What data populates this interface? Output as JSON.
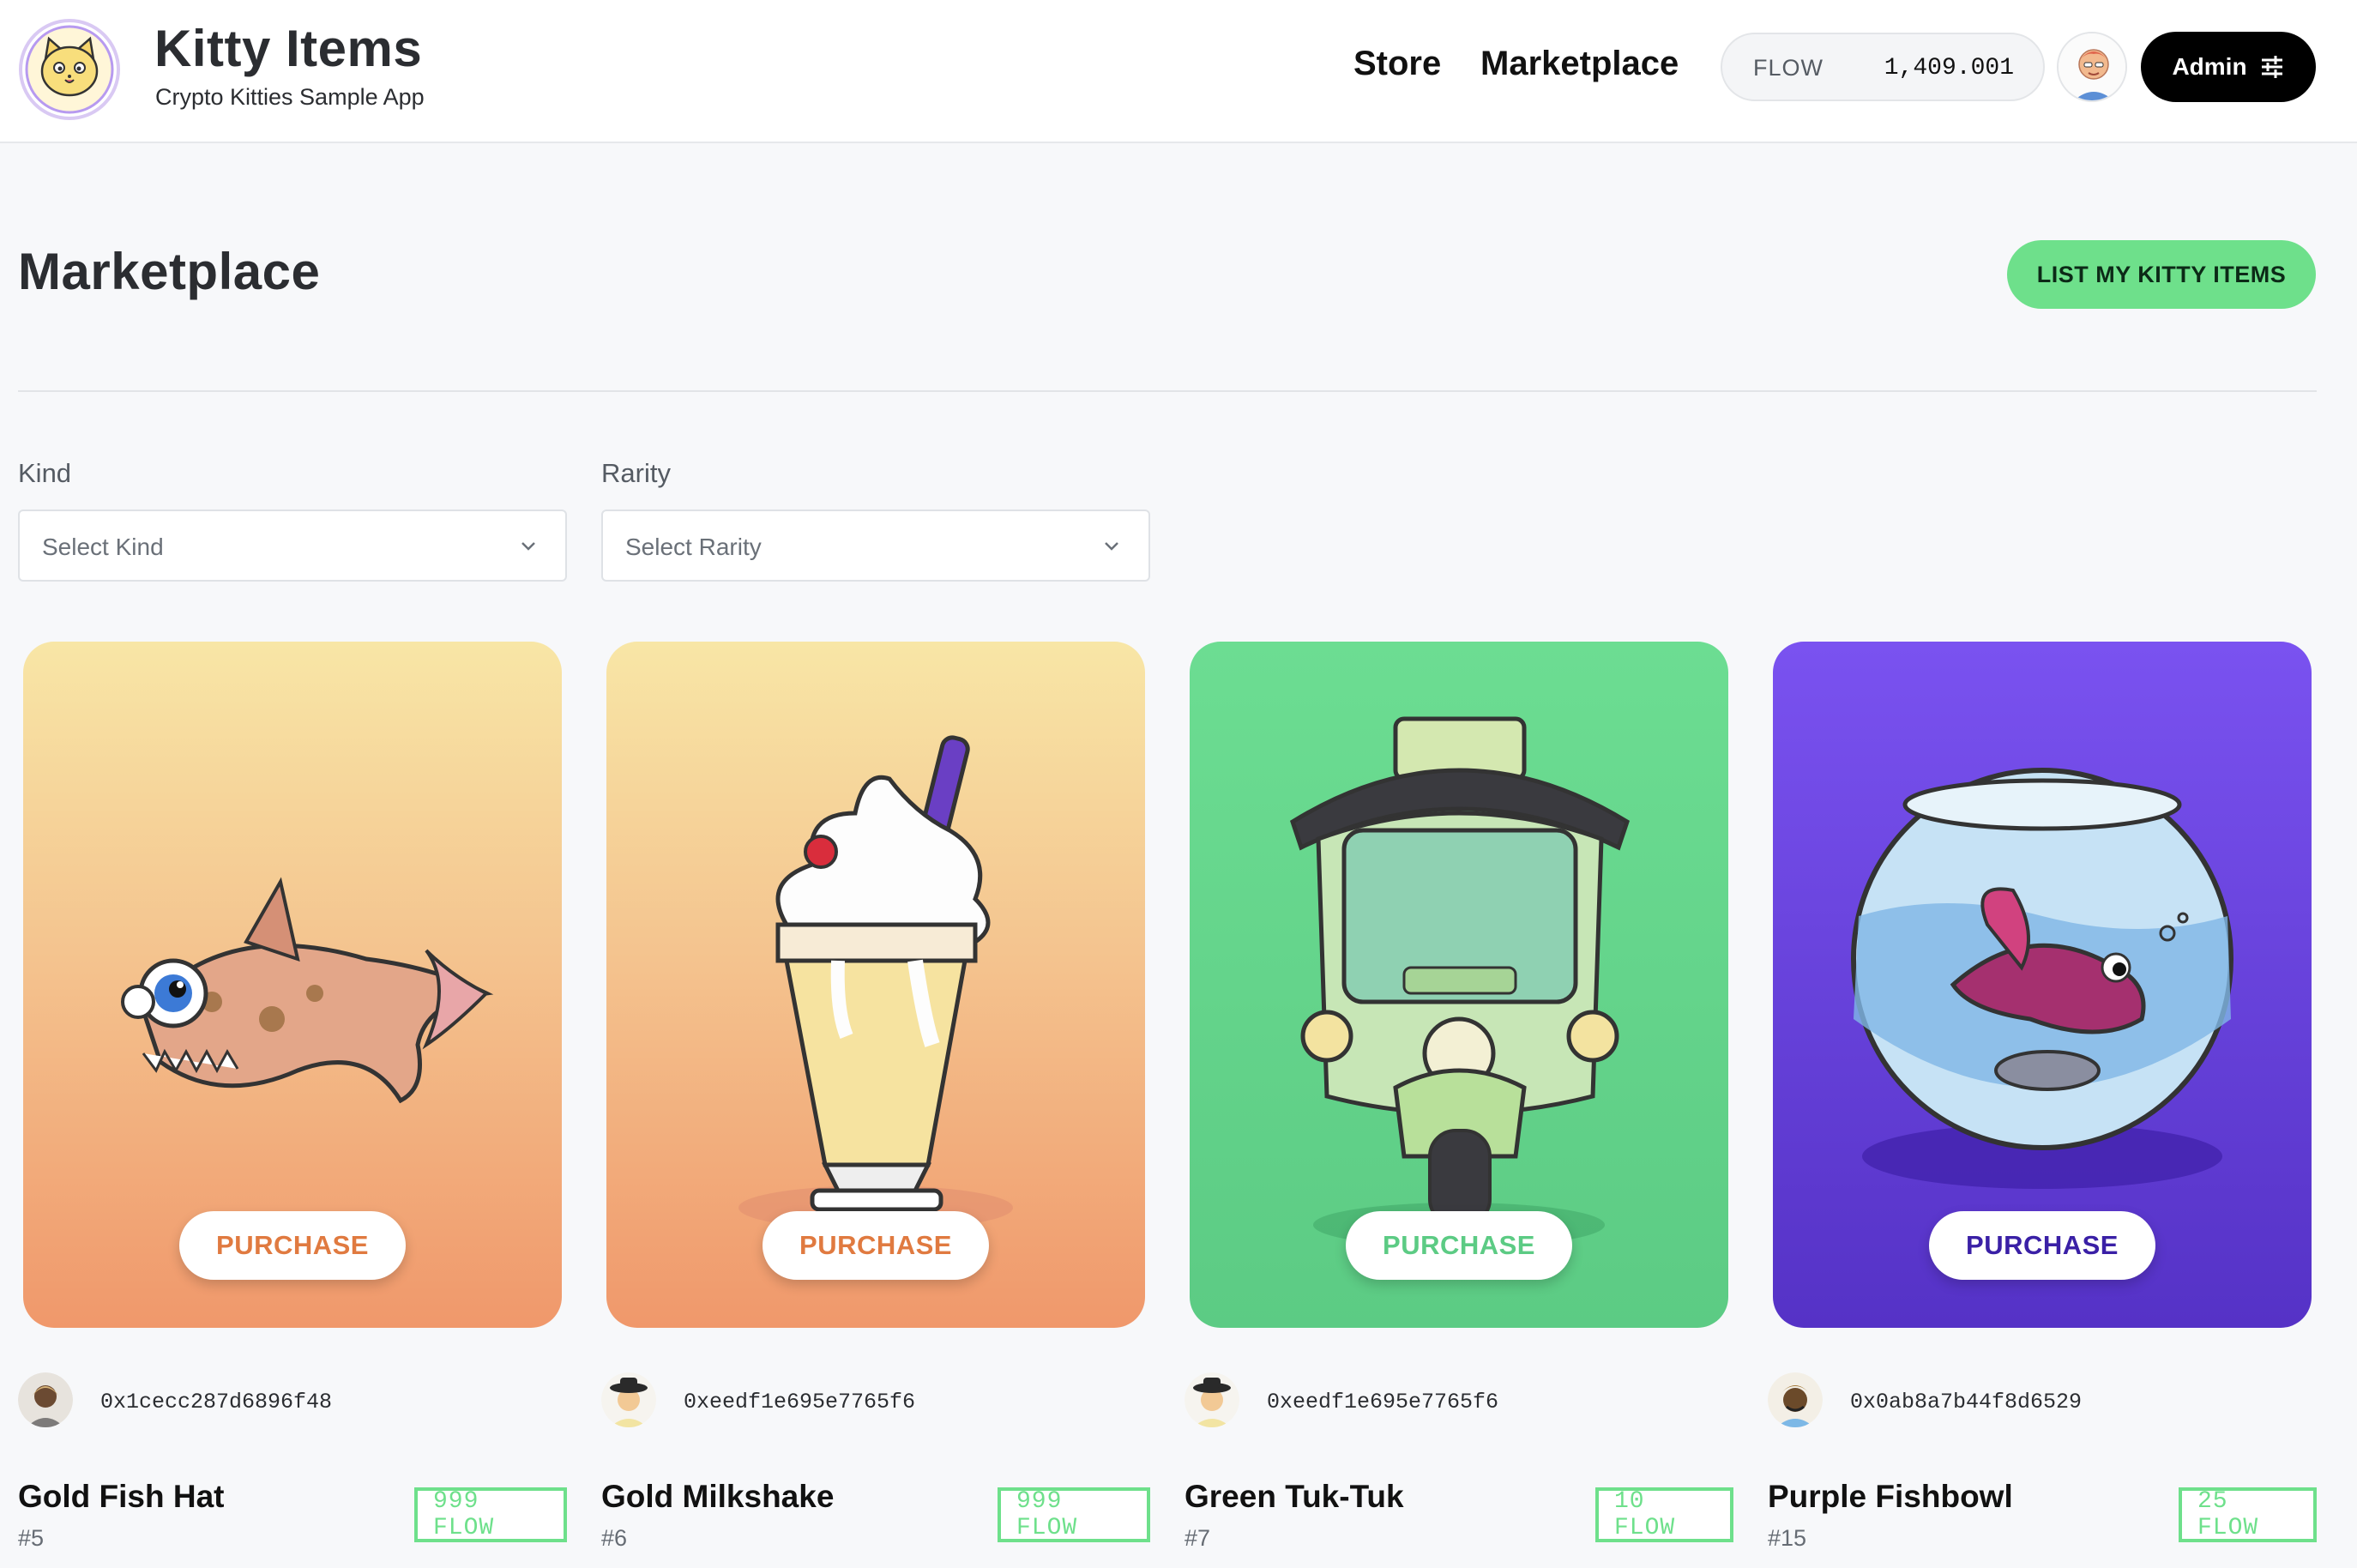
{
  "app": {
    "title": "Kitty Items",
    "subtitle": "Crypto Kitties Sample App",
    "logo_icon": "kitty-logo-icon"
  },
  "nav": {
    "store": "Store",
    "marketplace": "Marketplace"
  },
  "balance": {
    "currency": "FLOW",
    "amount": "1,409.001"
  },
  "admin": {
    "label": "Admin",
    "icon": "sliders-icon"
  },
  "page": {
    "title": "Marketplace",
    "list_button": "LIST MY KITTY ITEMS"
  },
  "filters": {
    "kind_label": "Kind",
    "kind_placeholder": "Select Kind",
    "rarity_label": "Rarity",
    "rarity_placeholder": "Select Rarity"
  },
  "colors": {
    "accent_green": "#6ee08b",
    "gold_start": "#f8e6a6",
    "gold_end": "#f0986b",
    "green_card": "#5ccb84",
    "purple_card": "#6b42e2",
    "purchase_gold": "#e07a40",
    "purchase_green": "#5ccb84",
    "purchase_purple": "#3a20a6"
  },
  "items": [
    {
      "name": "Gold Fish Hat",
      "id": "#5",
      "price": "999 FLOW",
      "owner": "0x1cecc287d6896f48",
      "purchase": "PURCHASE",
      "image": "fish-hat-image"
    },
    {
      "name": "Gold Milkshake",
      "id": "#6",
      "price": "999 FLOW",
      "owner": "0xeedf1e695e7765f6",
      "purchase": "PURCHASE",
      "image": "milkshake-image"
    },
    {
      "name": "Green Tuk-Tuk",
      "id": "#7",
      "price": "10 FLOW",
      "owner": "0xeedf1e695e7765f6",
      "purchase": "PURCHASE",
      "image": "tuk-tuk-image"
    },
    {
      "name": "Purple Fishbowl",
      "id": "#15",
      "price": "25 FLOW",
      "owner": "0x0ab8a7b44f8d6529",
      "purchase": "PURCHASE",
      "image": "fishbowl-image"
    }
  ]
}
